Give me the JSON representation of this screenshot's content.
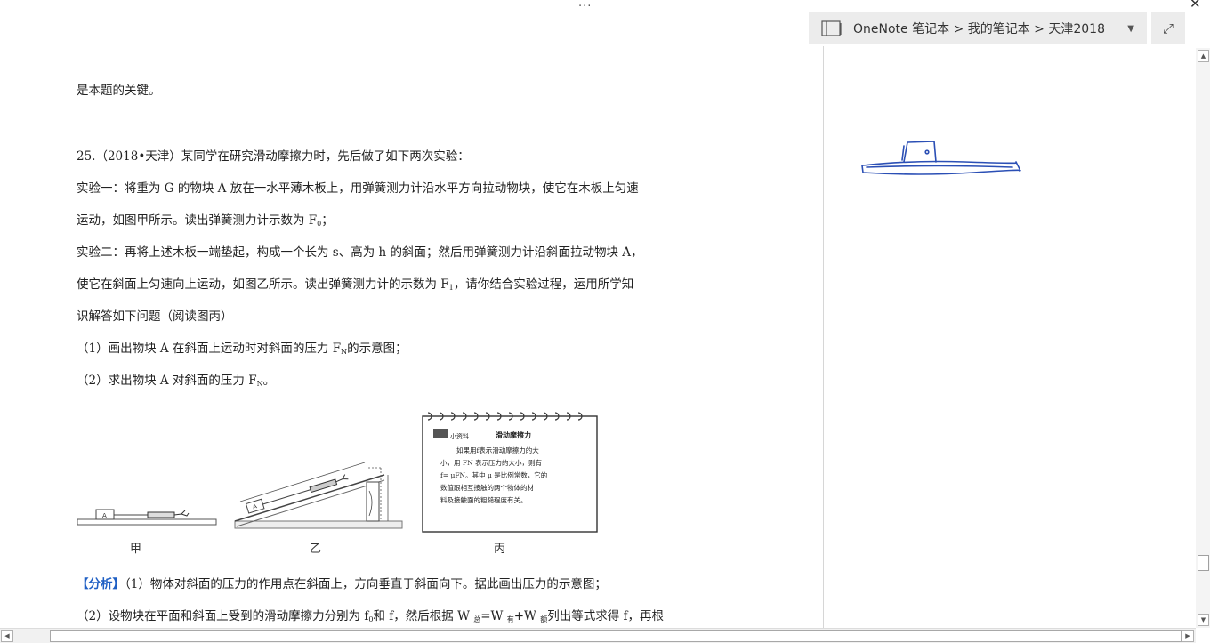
{
  "window": {
    "more_glyph": "···",
    "close_glyph": "✕"
  },
  "document": {
    "line0": "是本题的关键。",
    "q_line1": "25.（2018•天津）某同学在研究滑动摩擦力时，先后做了如下两次实验：",
    "q_line2": "实验一：将重为 G 的物块 A 放在一水平薄木板上，用弹簧测力计沿水平方向拉动物块，使它在木板上匀速",
    "q_line3_pre": "运动，如图甲所示。读出弹簧测力计示数为 F",
    "q_line3_sub": "0",
    "q_line3_post": "；",
    "q_line4": "实验二：再将上述木板一端垫起，构成一个长为 s、高为 h 的斜面；然后用弹簧测力计沿斜面拉动物块 A，",
    "q_line5_pre": "使它在斜面上匀速向上运动，如图乙所示。读出弹簧测力计的示数为 F",
    "q_line5_sub": "1",
    "q_line5_post": "，请你结合实验过程，运用所学知",
    "q_line6": "识解答如下问题（阅读图丙）",
    "q_item1_pre": "（1）画出物块 A 在斜面上运动时对斜面的压力 F",
    "q_item1_sub": "N",
    "q_item1_post": "的示意图；",
    "q_item2_pre": "（2）求出物块 A 对斜面的压力 F",
    "q_item2_sub": "N",
    "q_item2_post": "。",
    "analysis_label": "【分析】",
    "analysis_line1": "（1）物体对斜面的压力的作用点在斜面上，方向垂直于斜面向下。据此画出压力的示意图；",
    "analysis_line2_a": "（2）设物块在平面和斜面上受到的滑动摩擦力分别为 f",
    "analysis_line2_sub0": "0",
    "analysis_line2_b": "和 f，然后根据 W ",
    "analysis_line2_sub_total": "总",
    "analysis_line2_c": "=W ",
    "analysis_line2_sub_useful": "有",
    "analysis_line2_d": "+W ",
    "analysis_line2_sub_extra": "额",
    "analysis_line2_e": "列出等式求得 f，再根"
  },
  "figures": {
    "fig_a_caption": "甲",
    "fig_b_caption": "乙",
    "fig_c_caption": "丙",
    "block_label": "A",
    "card_tag": "小资料",
    "card_title": "滑动摩擦力",
    "card_lines": [
      "如果用f表示滑动摩擦力的大",
      "小，用 FN 表示压力的大小，则有",
      "f= μFN。其中 μ 是比例常数，它的",
      "数值跟相互接触的两个物体的材",
      "料及接触面的粗糙程度有关。"
    ]
  },
  "onenote": {
    "breadcrumb": "OneNote 笔记本 > 我的笔记本 > 天津2018",
    "notebook_icon": "notebook-icon",
    "dropdown_icon": "chevron-down-icon",
    "expand_icon": "expand-icon",
    "ink_color": "#2b4fb5"
  },
  "scrollbars": {
    "up": "▲",
    "down": "▼",
    "left": "◀",
    "right": "▶"
  }
}
